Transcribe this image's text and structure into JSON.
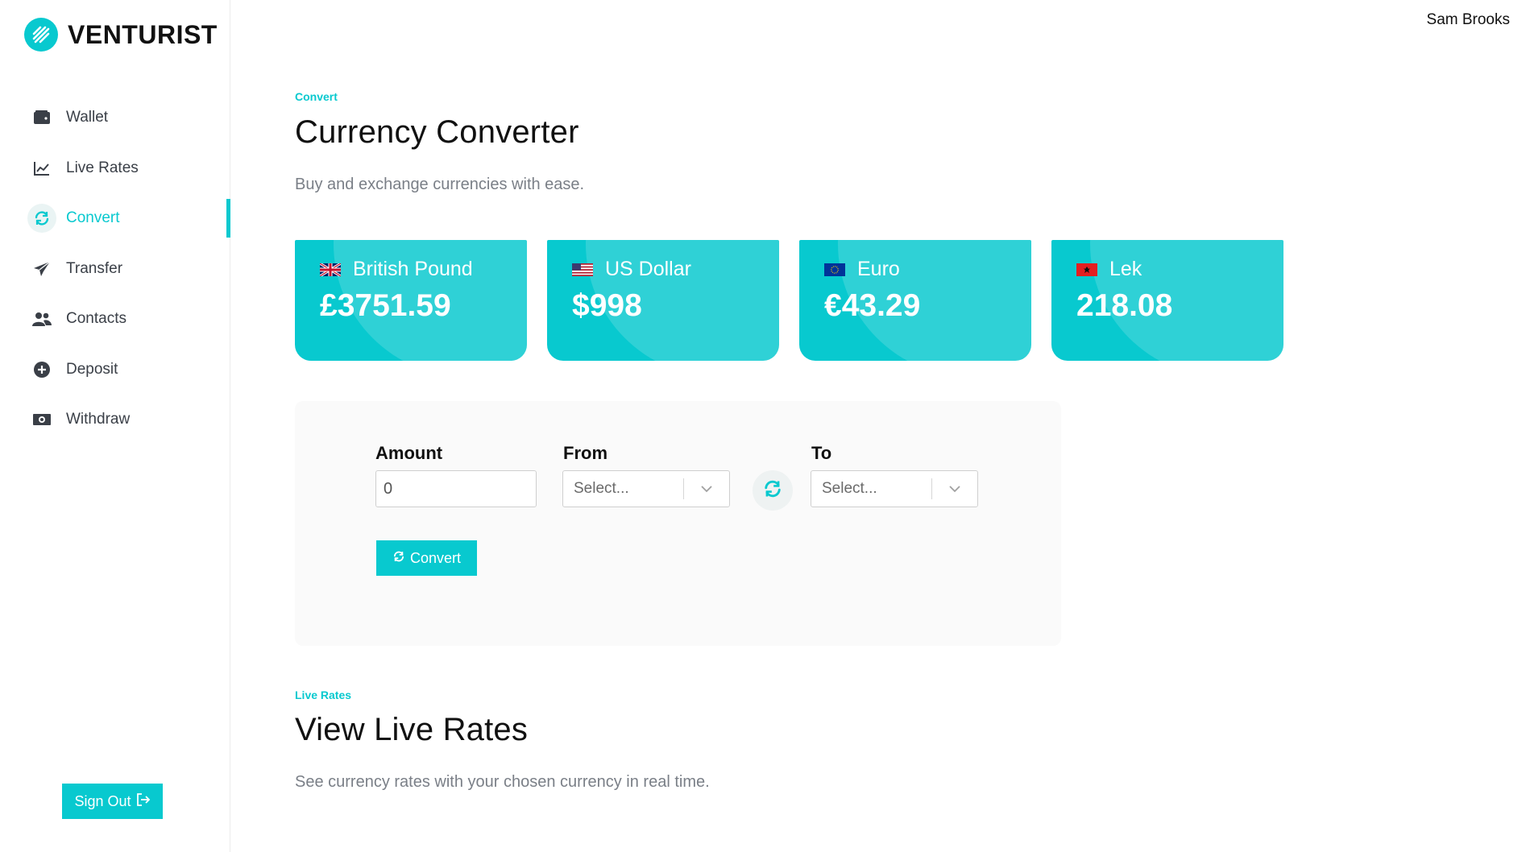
{
  "brand": {
    "name": "VENTURIST",
    "accent": "#08c9cf"
  },
  "header": {
    "user_name": "Sam Brooks"
  },
  "sidebar": {
    "items": [
      {
        "label": "Wallet",
        "icon": "wallet-icon",
        "active": false
      },
      {
        "label": "Live Rates",
        "icon": "chart-line-icon",
        "active": false
      },
      {
        "label": "Convert",
        "icon": "refresh-icon",
        "active": true
      },
      {
        "label": "Transfer",
        "icon": "paper-plane-icon",
        "active": false
      },
      {
        "label": "Contacts",
        "icon": "users-icon",
        "active": false
      },
      {
        "label": "Deposit",
        "icon": "plus-circle-icon",
        "active": false
      },
      {
        "label": "Withdraw",
        "icon": "money-bill-icon",
        "active": false
      }
    ],
    "sign_out_label": "Sign Out"
  },
  "convert_section": {
    "eyebrow": "Convert",
    "title": "Currency Converter",
    "subtitle": "Buy and exchange currencies with ease."
  },
  "cards": [
    {
      "name": "British Pound",
      "amount": "£3751.59",
      "flag": "uk-flag-icon"
    },
    {
      "name": "US Dollar",
      "amount": "$998",
      "flag": "us-flag-icon"
    },
    {
      "name": "Euro",
      "amount": "€43.29",
      "flag": "eu-flag-icon"
    },
    {
      "name": "Lek",
      "amount": "218.08",
      "flag": "albania-flag-icon"
    }
  ],
  "converter": {
    "amount_label": "Amount",
    "amount_value": "0",
    "from_label": "From",
    "from_value": "Select...",
    "to_label": "To",
    "to_value": "Select...",
    "convert_label": "Convert"
  },
  "live_rates_section": {
    "eyebrow": "Live Rates",
    "title": "View Live Rates",
    "subtitle": "See currency rates with your chosen currency in real time."
  }
}
